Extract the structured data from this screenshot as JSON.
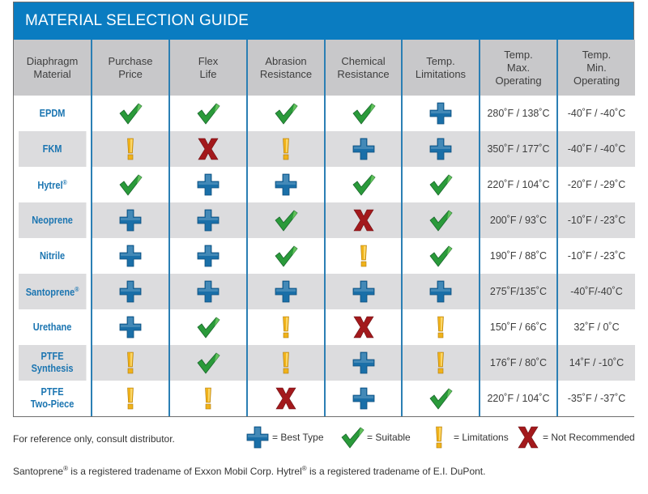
{
  "title": "MATERIAL SELECTION GUIDE",
  "columns": [
    {
      "line1": "Diaphragm",
      "line2": "Material",
      "line3": ""
    },
    {
      "line1": "Purchase",
      "line2": "Price",
      "line3": ""
    },
    {
      "line1": "Flex",
      "line2": "Life",
      "line3": ""
    },
    {
      "line1": "Abrasion",
      "line2": "Resistance",
      "line3": ""
    },
    {
      "line1": "Chemical",
      "line2": "Resistance",
      "line3": ""
    },
    {
      "line1": "Temp.",
      "line2": "Limitations",
      "line3": ""
    },
    {
      "line1": "Temp.",
      "line2": "Max.",
      "line3": "Operating"
    },
    {
      "line1": "Temp.",
      "line2": "Min.",
      "line3": "Operating"
    }
  ],
  "rows": [
    {
      "material": [
        "EPDM",
        ""
      ],
      "reg": false,
      "ratings": [
        "suitable",
        "suitable",
        "suitable",
        "suitable",
        "best"
      ],
      "max": "280˚F / 138˚C",
      "min": "-40˚F / -40˚C"
    },
    {
      "material": [
        "FKM",
        ""
      ],
      "reg": false,
      "ratings": [
        "limitations",
        "not-recommended",
        "limitations",
        "best",
        "best"
      ],
      "max": "350˚F / 177˚C",
      "min": "-40˚F / -40˚C"
    },
    {
      "material": [
        "Hytrel",
        ""
      ],
      "reg": true,
      "ratings": [
        "suitable",
        "best",
        "best",
        "suitable",
        "suitable"
      ],
      "max": "220˚F / 104˚C",
      "min": "-20˚F / -29˚C"
    },
    {
      "material": [
        "Neoprene",
        ""
      ],
      "reg": false,
      "ratings": [
        "best",
        "best",
        "suitable",
        "not-recommended",
        "suitable"
      ],
      "max": "200˚F / 93˚C",
      "min": "-10˚F / -23˚C"
    },
    {
      "material": [
        "Nitrile",
        ""
      ],
      "reg": false,
      "ratings": [
        "best",
        "best",
        "suitable",
        "limitations",
        "suitable"
      ],
      "max": "190˚F / 88˚C",
      "min": "-10˚F / -23˚C"
    },
    {
      "material": [
        "Santoprene",
        ""
      ],
      "reg": true,
      "ratings": [
        "best",
        "best",
        "best",
        "best",
        "best"
      ],
      "max": "275˚F/135˚C",
      "min": "-40˚F/-40˚C"
    },
    {
      "material": [
        "Urethane",
        ""
      ],
      "reg": false,
      "ratings": [
        "best",
        "suitable",
        "limitations",
        "not-recommended",
        "limitations"
      ],
      "max": "150˚F / 66˚C",
      "min": "32˚F / 0˚C"
    },
    {
      "material": [
        "PTFE",
        "Synthesis"
      ],
      "reg": false,
      "ratings": [
        "limitations",
        "suitable",
        "limitations",
        "best",
        "limitations"
      ],
      "max": "176˚F / 80˚C",
      "min": "14˚F / -10˚C"
    },
    {
      "material": [
        "PTFE",
        "Two-Piece"
      ],
      "reg": false,
      "ratings": [
        "limitations",
        "limitations",
        "not-recommended",
        "best",
        "suitable"
      ],
      "max": "220˚F / 104˚C",
      "min": "-35˚F / -37˚C"
    }
  ],
  "reg_mark": "®",
  "note": "For reference only, consult distributor.",
  "legend": [
    {
      "icon": "best",
      "label": "= Best Type"
    },
    {
      "icon": "suitable",
      "label": "= Suitable"
    },
    {
      "icon": "limitations",
      "label": "= Limitations"
    },
    {
      "icon": "not-recommended",
      "label": "= Not Recommended"
    }
  ],
  "footer": {
    "part1": "Santoprene",
    "part2": " is a registered tradename of Exxon Mobil Corp. Hytrel",
    "part3": " is a registered tradename of E.I. DuPont."
  },
  "colors": {
    "brand_blue": "#0a7cc1",
    "best": "#1a6fa8",
    "suitable": "#2a9a3a",
    "limitations": "#f0b21a",
    "not_recommended": "#a3191c"
  }
}
